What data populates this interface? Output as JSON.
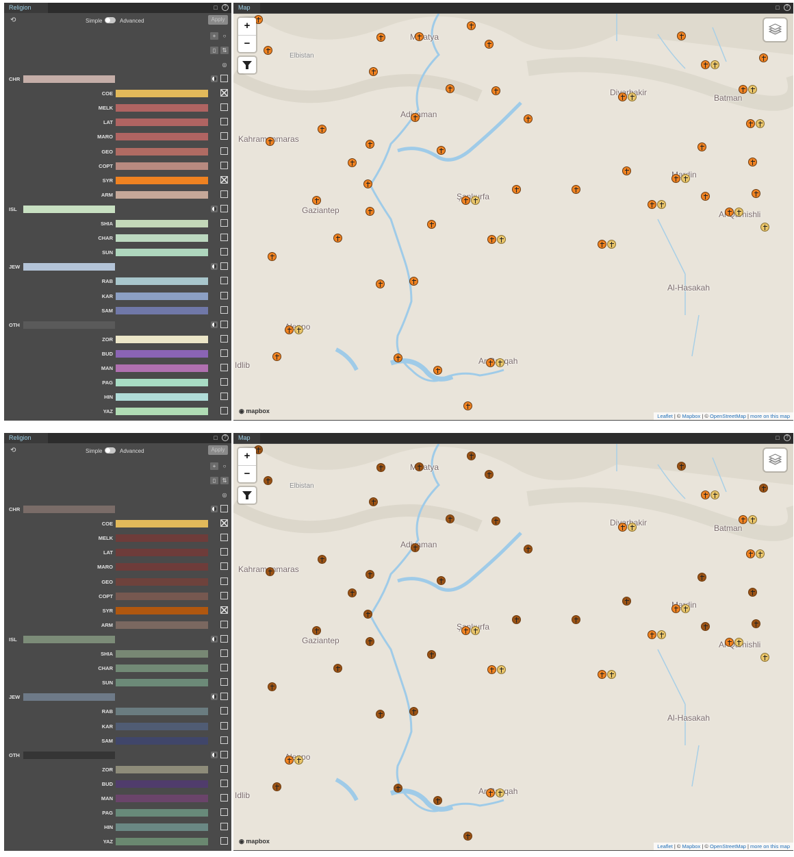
{
  "religion_panel": {
    "tab": "Religion",
    "mode_simple": "Simple",
    "mode_advanced": "Advanced",
    "apply_label": "Apply"
  },
  "map_panel": {
    "tab": "Map",
    "zoom_in": "+",
    "zoom_out": "−",
    "mapbox_logo": "mapbox",
    "attribution": {
      "leaflet": "Leaflet",
      "mapbox": "Mapbox",
      "osm": "OpenStreetMap",
      "more": "more on this map",
      "sep1": " | © ",
      "sep2": " | © ",
      "sep3": " | "
    }
  },
  "cities": [
    {
      "name": "Malatya"
    },
    {
      "name": "Elbistan"
    },
    {
      "name": "Diyarbakir"
    },
    {
      "name": "Batman"
    },
    {
      "name": "Adiyaman"
    },
    {
      "name": "Kahramanmaras"
    },
    {
      "name": "Mardin"
    },
    {
      "name": "Şanlıurfa"
    },
    {
      "name": "Gaziantep"
    },
    {
      "name": "Al-Qamishli"
    },
    {
      "name": "Al-Hasakah"
    },
    {
      "name": "Aleppo"
    },
    {
      "name": "Idlib"
    },
    {
      "name": "Ar Raqqah"
    }
  ],
  "top_screen": {
    "rows": [
      {
        "code": "CHR",
        "type": "parent",
        "color": "#c5aea8",
        "checked": false
      },
      {
        "code": "COE",
        "type": "child",
        "color": "#e2b95a",
        "checked": true
      },
      {
        "code": "MELK",
        "type": "child",
        "color": "#b06462",
        "checked": false
      },
      {
        "code": "LAT",
        "type": "child",
        "color": "#b06462",
        "checked": false
      },
      {
        "code": "MARO",
        "type": "child",
        "color": "#b06462",
        "checked": false
      },
      {
        "code": "GEO",
        "type": "child",
        "color": "#b06b63",
        "checked": false
      },
      {
        "code": "COPT",
        "type": "child",
        "color": "#b88a80",
        "checked": false
      },
      {
        "code": "SYR",
        "type": "child",
        "color": "#ef8221",
        "checked": true
      },
      {
        "code": "ARM",
        "type": "child",
        "color": "#c5a899",
        "checked": false
      },
      {
        "code": "ISL",
        "type": "parent",
        "color": "#c8e0c2",
        "checked": false
      },
      {
        "code": "SHIA",
        "type": "child",
        "color": "#c3d8b8",
        "checked": false
      },
      {
        "code": "CHAR",
        "type": "child",
        "color": "#bcd9c0",
        "checked": false
      },
      {
        "code": "SUN",
        "type": "child",
        "color": "#aed6bd",
        "checked": false
      },
      {
        "code": "JEW",
        "type": "parent",
        "color": "#b4c4d8",
        "checked": false
      },
      {
        "code": "RAB",
        "type": "child",
        "color": "#a8c6cc",
        "checked": false
      },
      {
        "code": "KAR",
        "type": "child",
        "color": "#8ca0c4",
        "checked": false
      },
      {
        "code": "SAM",
        "type": "child",
        "color": "#7078a8",
        "checked": false
      },
      {
        "code": "OTH",
        "type": "parent",
        "color": "#5a5a5a",
        "checked": false
      },
      {
        "code": "ZOR",
        "type": "child",
        "color": "#ece6c8",
        "checked": false
      },
      {
        "code": "BUD",
        "type": "child",
        "color": "#8a64b4",
        "checked": false
      },
      {
        "code": "MAN",
        "type": "child",
        "color": "#b070b0",
        "checked": false
      },
      {
        "code": "PAG",
        "type": "child",
        "color": "#a8dcc4",
        "checked": false
      },
      {
        "code": "HIN",
        "type": "child",
        "color": "#b0dcd8",
        "checked": false
      },
      {
        "code": "YAZ",
        "type": "child",
        "color": "#b0dcb4",
        "checked": false
      }
    ],
    "marker_colors": {
      "syr": "#ef8221",
      "coe": "#e8c46a",
      "dim": "#ef8221"
    }
  },
  "bottom_screen": {
    "rows": [
      {
        "code": "CHR",
        "type": "parent",
        "color": "#7a6c68",
        "checked": false
      },
      {
        "code": "COE",
        "type": "child",
        "color": "#e2b95a",
        "checked": true
      },
      {
        "code": "MELK",
        "type": "child",
        "color": "#6e3c3a",
        "checked": false
      },
      {
        "code": "LAT",
        "type": "child",
        "color": "#6e3c3a",
        "checked": false
      },
      {
        "code": "MARO",
        "type": "child",
        "color": "#6e3c3a",
        "checked": false
      },
      {
        "code": "GEO",
        "type": "child",
        "color": "#6e423c",
        "checked": false
      },
      {
        "code": "COPT",
        "type": "child",
        "color": "#765850",
        "checked": false
      },
      {
        "code": "SYR",
        "type": "child",
        "color": "#b0570f",
        "checked": true
      },
      {
        "code": "ARM",
        "type": "child",
        "color": "#7a6860",
        "checked": false
      },
      {
        "code": "ISL",
        "type": "parent",
        "color": "#7c8c78",
        "checked": false
      },
      {
        "code": "SHIA",
        "type": "child",
        "color": "#788874",
        "checked": false
      },
      {
        "code": "CHAR",
        "type": "child",
        "color": "#728a76",
        "checked": false
      },
      {
        "code": "SUN",
        "type": "child",
        "color": "#6c8a78",
        "checked": false
      },
      {
        "code": "JEW",
        "type": "parent",
        "color": "#6e7a88",
        "checked": false
      },
      {
        "code": "RAB",
        "type": "child",
        "color": "#6a7c80",
        "checked": false
      },
      {
        "code": "KAR",
        "type": "child",
        "color": "#505c74",
        "checked": false
      },
      {
        "code": "SAM",
        "type": "child",
        "color": "#40466a",
        "checked": false
      },
      {
        "code": "OTH",
        "type": "parent",
        "color": "#353535",
        "checked": false
      },
      {
        "code": "ZOR",
        "type": "child",
        "color": "#8e8c7a",
        "checked": false
      },
      {
        "code": "BUD",
        "type": "child",
        "color": "#503c6c",
        "checked": false
      },
      {
        "code": "MAN",
        "type": "child",
        "color": "#6a446a",
        "checked": false
      },
      {
        "code": "PAG",
        "type": "child",
        "color": "#688a7a",
        "checked": false
      },
      {
        "code": "HIN",
        "type": "child",
        "color": "#6a8884",
        "checked": false
      },
      {
        "code": "YAZ",
        "type": "child",
        "color": "#6a8870",
        "checked": false
      }
    ],
    "marker_colors": {
      "syr": "#ef8221",
      "coe": "#e8c46a",
      "dim": "#9a5214"
    }
  }
}
